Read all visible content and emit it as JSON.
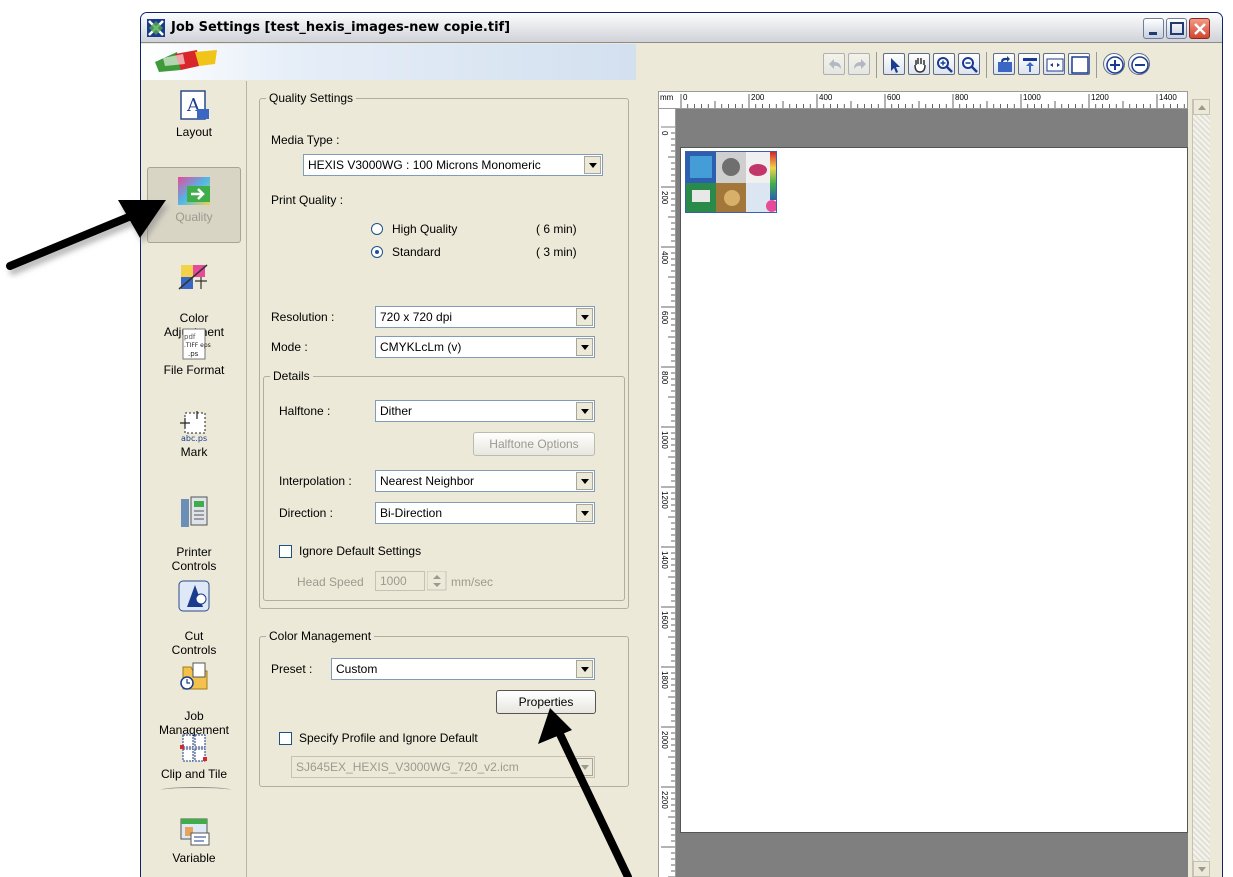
{
  "window": {
    "title": "Job Settings [test_hexis_images-new copie.tif]"
  },
  "nav": {
    "items": [
      {
        "label": "Layout"
      },
      {
        "label": "Quality"
      },
      {
        "label": "Color\nAdjustment"
      },
      {
        "label": "File Format"
      },
      {
        "label": "Mark"
      },
      {
        "label": "Printer\nControls"
      },
      {
        "label": "Cut\nControls"
      },
      {
        "label": "Job\nManagement"
      },
      {
        "label": "Clip and Tile"
      },
      {
        "label": "Variable"
      }
    ]
  },
  "quality": {
    "legend": "Quality Settings",
    "media_type_label": "Media Type :",
    "media_type_value": "HEXIS V3000WG : 100 Microns Monomeric",
    "print_quality_label": "Print Quality :",
    "options": [
      {
        "label": "High Quality",
        "time": "( 6 min)"
      },
      {
        "label": "Standard",
        "time": "( 3 min)"
      }
    ],
    "selected_option": "Standard",
    "resolution_label": "Resolution :",
    "resolution_value": "720 x 720 dpi",
    "mode_label": "Mode :",
    "mode_value": "CMYKLcLm (v)"
  },
  "details": {
    "legend": "Details",
    "halftone_label": "Halftone :",
    "halftone_value": "Dither",
    "halftone_options_button": "Halftone Options",
    "interpolation_label": "Interpolation :",
    "interpolation_value": "Nearest Neighbor",
    "direction_label": "Direction :",
    "direction_value": "Bi-Direction",
    "ignore_label": "Ignore Default Settings",
    "head_speed_label": "Head Speed",
    "head_speed_value": "1000",
    "head_speed_unit": "mm/sec"
  },
  "color_management": {
    "legend": "Color Management",
    "preset_label": "Preset :",
    "preset_value": "Custom",
    "properties_button": "Properties",
    "specify_label": "Specify Profile and Ignore Default",
    "profile_value": "SJ645EX_HEXIS_V3000WG_720_v2.icm"
  },
  "ruler": {
    "unit": "mm",
    "top_ticks": [
      "0",
      "200",
      "400",
      "600",
      "800",
      "1000",
      "1200",
      "1400"
    ],
    "left_ticks": [
      "0",
      "200",
      "400",
      "600",
      "800",
      "1000",
      "1200",
      "1400",
      "1600",
      "1800",
      "2000",
      "2200"
    ]
  },
  "toolbar": {
    "icons": [
      "undo-icon",
      "redo-icon",
      "pointer-icon",
      "hand-icon",
      "zoom-in-icon",
      "zoom-out-icon",
      "rotate-icon",
      "align-icon",
      "fit-width-icon",
      "fit-page-icon",
      "plus-icon",
      "minus-icon"
    ]
  }
}
